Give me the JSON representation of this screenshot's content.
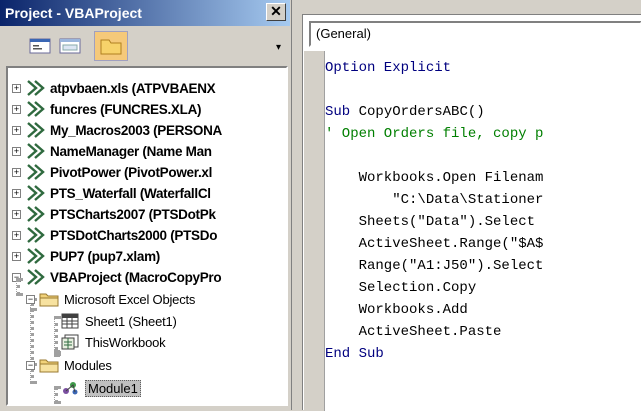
{
  "project_window": {
    "title": "Project - VBAProject",
    "close_label": "✕",
    "projects": [
      {
        "label": "atpvbaen.xls (ATPVBAENX"
      },
      {
        "label": "funcres (FUNCRES.XLA)"
      },
      {
        "label": "My_Macros2003 (PERSONA"
      },
      {
        "label": "NameManager (Name Man"
      },
      {
        "label": "PivotPower (PivotPower.xl"
      },
      {
        "label": "PTS_Waterfall (WaterfallCl"
      },
      {
        "label": "PTSCharts2007 (PTSDotPk"
      },
      {
        "label": "PTSDotCharts2000 (PTSDo"
      },
      {
        "label": "PUP7 (pup7.xlam)"
      },
      {
        "label": "VBAProject (MacroCopyPro"
      }
    ],
    "excel_objects_folder": "Microsoft Excel Objects",
    "sheet1": "Sheet1 (Sheet1)",
    "this_workbook": "ThisWorkbook",
    "modules_folder": "Modules",
    "module1": "Module1"
  },
  "code_window": {
    "object_dropdown": "(General)",
    "lines": [
      {
        "text": "Option Explicit",
        "style": "kw"
      },
      {
        "text": "",
        "style": ""
      },
      {
        "text": "Sub CopyOrdersABC()",
        "style": "sub"
      },
      {
        "text": "' Open Orders file, copy p",
        "style": "cm"
      },
      {
        "text": "",
        "style": ""
      },
      {
        "text": "    Workbooks.Open Filenam",
        "style": ""
      },
      {
        "text": "        \"C:\\Data\\Stationer",
        "style": ""
      },
      {
        "text": "    Sheets(\"Data\").Select",
        "style": ""
      },
      {
        "text": "    ActiveSheet.Range(\"$A$",
        "style": ""
      },
      {
        "text": "    Range(\"A1:J50\").Select",
        "style": ""
      },
      {
        "text": "    Selection.Copy",
        "style": ""
      },
      {
        "text": "    Workbooks.Add",
        "style": ""
      },
      {
        "text": "    ActiveSheet.Paste",
        "style": ""
      },
      {
        "text": "End Sub",
        "style": "kw"
      }
    ]
  },
  "colors": {
    "title_bar": "#0a246a",
    "keyword": "#00007f",
    "comment": "#007f00"
  }
}
